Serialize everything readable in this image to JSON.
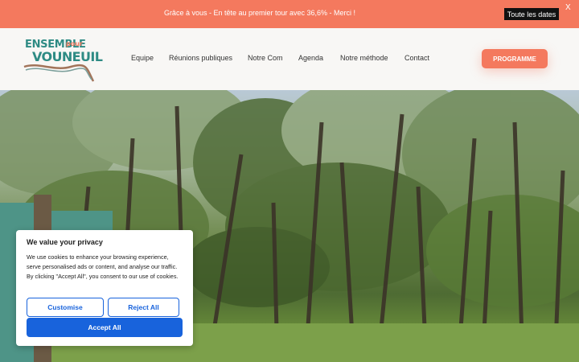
{
  "announcement": {
    "text": "Grâce à vous - En tête au premier tour avec 36,6% - Merci !",
    "button": "Toute les dates",
    "close": "X"
  },
  "logo": {
    "line1": "ENSEMBLE",
    "line1_small": "pour",
    "line2": "VOUNEUIL"
  },
  "nav": {
    "items": [
      "Equipe",
      "Réunions publiques",
      "Notre Com",
      "Agenda",
      "Notre méthode",
      "Contact"
    ],
    "cta": "PROGRAMME"
  },
  "cookie": {
    "title": "We value your privacy",
    "body": "We use cookies to enhance your browsing experience, serve personalised ads or content, and analyse our traffic. By clicking \"Accept All\", you consent to our use of cookies.",
    "customise": "Customise",
    "reject": "Reject All",
    "accept": "Accept All"
  },
  "colors": {
    "accent": "#f4795e",
    "brand_teal": "#2e8b84",
    "cookie_blue": "#1863dc"
  }
}
